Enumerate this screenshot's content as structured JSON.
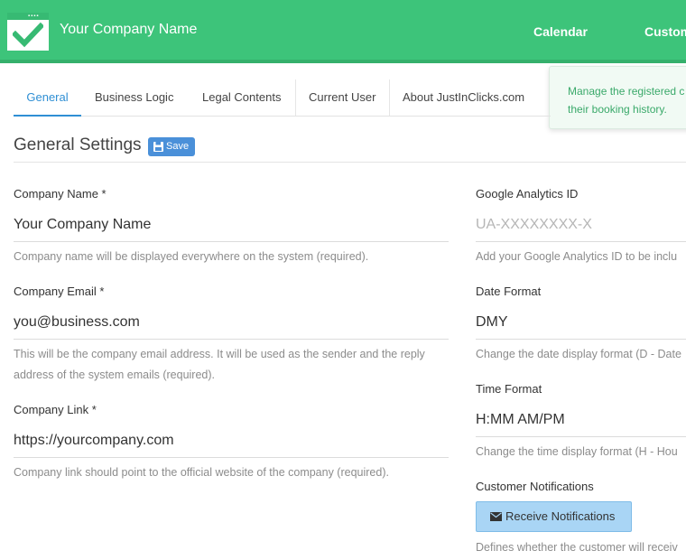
{
  "header": {
    "company_name": "Your Company Name",
    "nav": {
      "calendar": "Calendar",
      "customers": "Custom"
    },
    "color": "#3dc47a"
  },
  "tooltip": {
    "line1": "Manage the registered c",
    "line2": "their booking history."
  },
  "tabs": [
    {
      "label": "General",
      "active": true
    },
    {
      "label": "Business Logic"
    },
    {
      "label": "Legal Contents"
    },
    {
      "label": "Current User"
    },
    {
      "label": "About JustInClicks.com"
    }
  ],
  "section": {
    "title": "General Settings",
    "save_label": "Save"
  },
  "left_fields": {
    "company_name": {
      "label": "Company Name *",
      "value": "Your Company Name",
      "help": "Company name will be displayed everywhere on the system (required)."
    },
    "company_email": {
      "label": "Company Email *",
      "value": "you@business.com",
      "help_line1": "This will be the company email address. It will be used as the sender and the reply",
      "help_line2": "address of the system emails (required)."
    },
    "company_link": {
      "label": "Company Link *",
      "value": "https://yourcompany.com",
      "help": "Company link should point to the official website of the company (required)."
    }
  },
  "right_fields": {
    "google_analytics": {
      "label": "Google Analytics ID",
      "placeholder": "UA-XXXXXXXX-X",
      "help": "Add your Google Analytics ID to be inclu"
    },
    "date_format": {
      "label": "Date Format",
      "value": "DMY",
      "help": "Change the date display format (D - Date"
    },
    "time_format": {
      "label": "Time Format",
      "value": "H:MM AM/PM",
      "help": "Change the time display format (H - Hou"
    },
    "customer_notifications": {
      "label": "Customer Notifications",
      "button_label": "Receive Notifications",
      "help": "Defines whether the customer will receiv"
    }
  }
}
